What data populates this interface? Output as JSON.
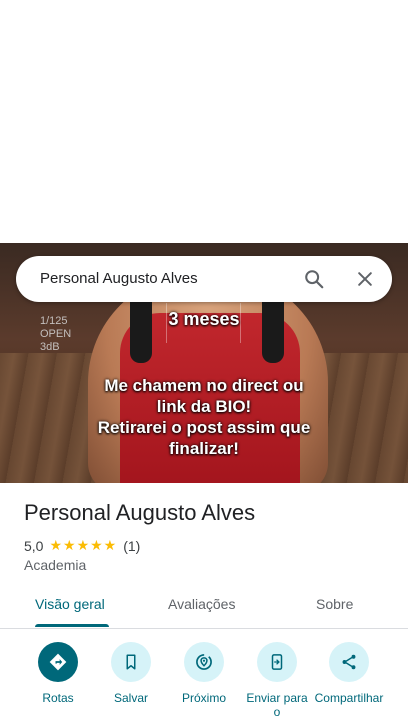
{
  "search": {
    "query": "Personal Augusto Alves"
  },
  "hero": {
    "overlay_lines": [
      "3 meses"
    ],
    "caption_lines": [
      "Me chamem no direct ou",
      "link da BIO!",
      "Retirarei o post assim que",
      "finalizar!"
    ],
    "camera_text": [
      "1/125",
      "OPEN",
      "3dB"
    ]
  },
  "place": {
    "name": "Personal Augusto Alves",
    "rating": "5,0",
    "stars": "★★★★★",
    "review_count": "(1)",
    "category": "Academia"
  },
  "tabs": [
    {
      "label": "Visão geral",
      "active": true
    },
    {
      "label": "Avaliações",
      "active": false
    },
    {
      "label": "Sobre",
      "active": false
    }
  ],
  "actions": [
    {
      "label": "Rotas",
      "icon": "directions-icon"
    },
    {
      "label": "Salvar",
      "icon": "bookmark-icon"
    },
    {
      "label": "Próximo",
      "icon": "nearby-icon"
    },
    {
      "label": "Enviar para o",
      "icon": "send-to-phone-icon"
    },
    {
      "label": "Compartilhar",
      "icon": "share-icon"
    }
  ],
  "colors": {
    "accent": "#00687a",
    "accent_light": "#d6f3f8",
    "star": "#fbbc04"
  }
}
